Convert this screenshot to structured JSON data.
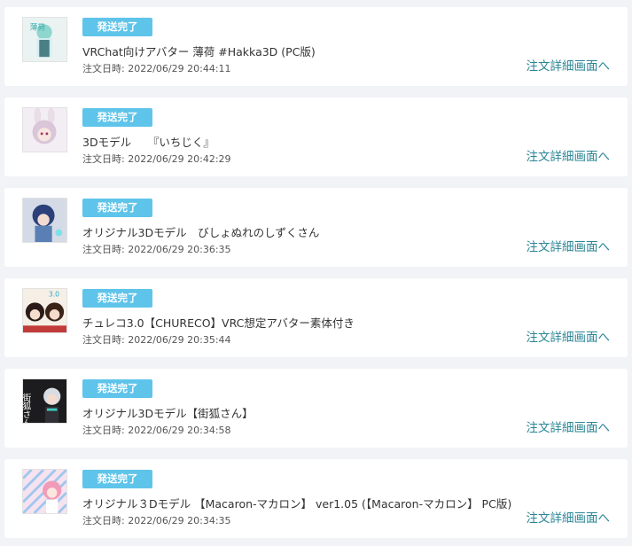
{
  "orders": [
    {
      "status": "発送完了",
      "title": "VRChat向けアバター 薄荷 #Hakka3D (PC版)",
      "date_label": "注文日時:",
      "date_value": "2022/06/29 20:44:11",
      "detail_link": "注文詳細画面へ",
      "thumb_text": "薄荷"
    },
    {
      "status": "発送完了",
      "title": "3Dモデル　　『いちじく』",
      "date_label": "注文日時:",
      "date_value": "2022/06/29 20:42:29",
      "detail_link": "注文詳細画面へ",
      "thumb_text": ""
    },
    {
      "status": "発送完了",
      "title": "オリジナル3Dモデル　びしょぬれのしずくさん",
      "date_label": "注文日時:",
      "date_value": "2022/06/29 20:36:35",
      "detail_link": "注文詳細画面へ",
      "thumb_text": ""
    },
    {
      "status": "発送完了",
      "title": "チュレコ3.0【CHURECO】VRC想定アバター素体付き",
      "date_label": "注文日時:",
      "date_value": "2022/06/29 20:35:44",
      "detail_link": "注文詳細画面へ",
      "thumb_text": "3.0"
    },
    {
      "status": "発送完了",
      "title": "オリジナル3Dモデル【街狐さん】",
      "date_label": "注文日時:",
      "date_value": "2022/06/29 20:34:58",
      "detail_link": "注文詳細画面へ",
      "thumb_text": "街狐さん"
    },
    {
      "status": "発送完了",
      "title": "オリジナル３Dモデル 【Macaron-マカロン】 ver1.05 (【Macaron-マカロン】 PC版)",
      "date_label": "注文日時:",
      "date_value": "2022/06/29 20:34:35",
      "detail_link": "注文詳細画面へ",
      "thumb_text": ""
    }
  ],
  "colors": {
    "badge": "#5fc4ea",
    "link": "#2a8595",
    "background": "#f1f3f6"
  }
}
